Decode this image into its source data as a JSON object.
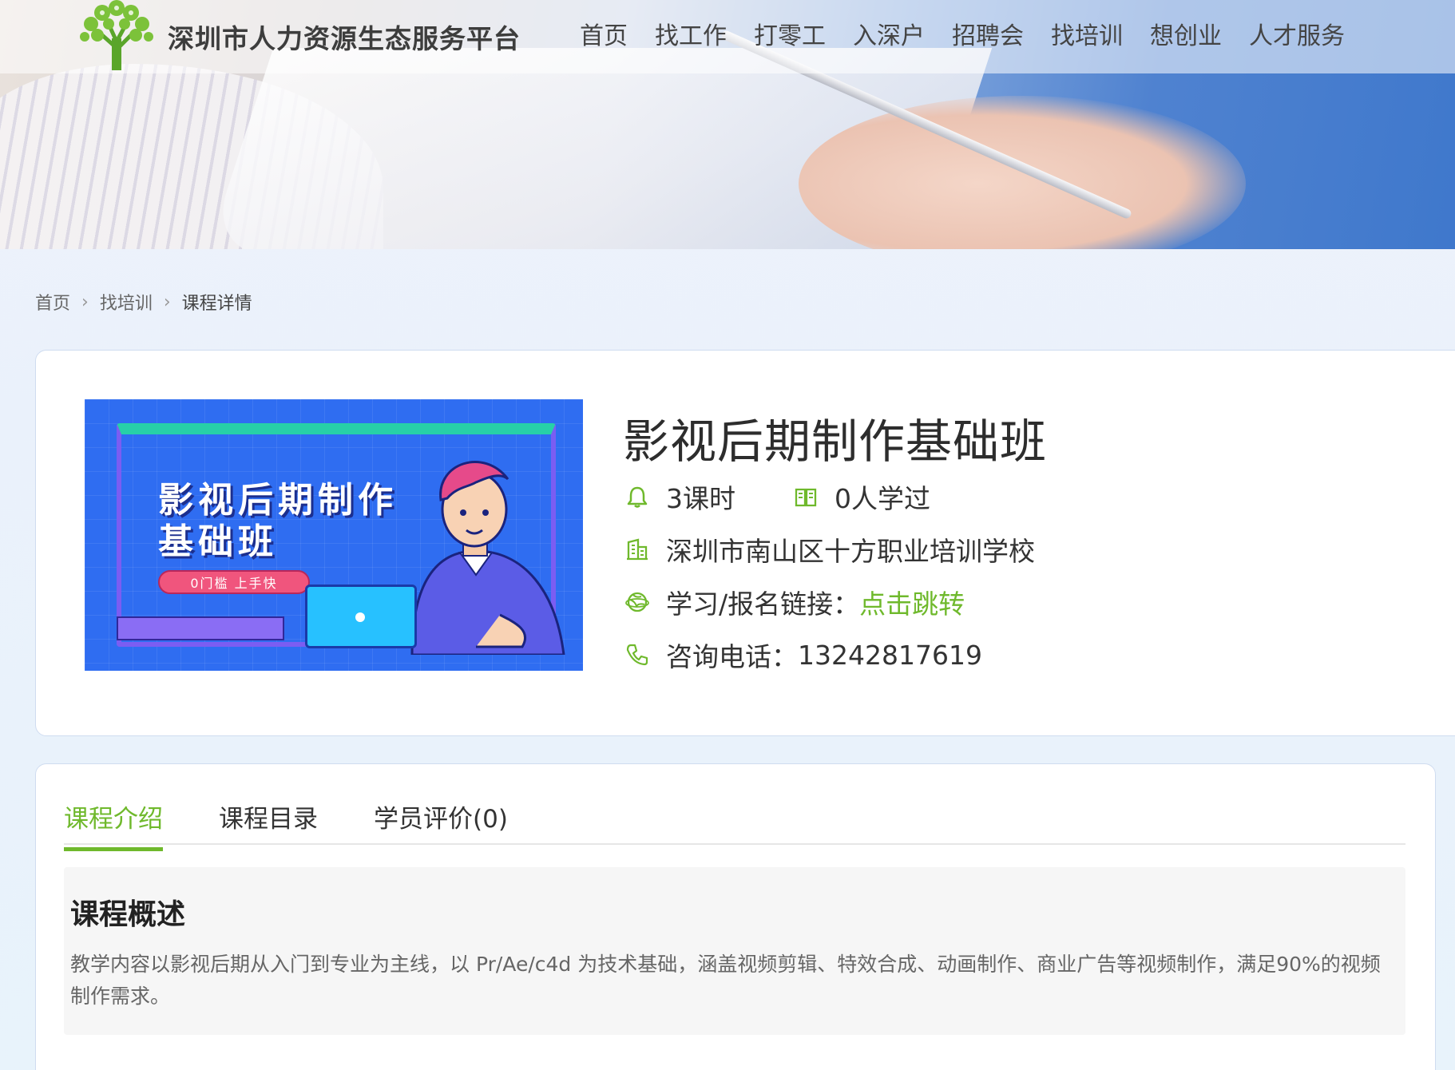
{
  "site": {
    "name": "深圳市人力资源生态服务平台"
  },
  "nav": {
    "items": [
      "首页",
      "找工作",
      "打零工",
      "入深户",
      "招聘会",
      "找培训",
      "想创业",
      "人才服务"
    ]
  },
  "breadcrumb": {
    "items": [
      "首页",
      "找培训",
      "课程详情"
    ]
  },
  "course": {
    "cover": {
      "title_line1": "影视后期制作",
      "title_line2": "基础班",
      "tagline": "0门槛 上手快"
    },
    "title": "影视后期制作基础班",
    "hours": "3课时",
    "learners": "0人学过",
    "school": "深圳市南山区十方职业培训学校",
    "link_label": "学习/报名链接：",
    "link_text": "点击跳转",
    "phone_label": "咨询电话：",
    "phone": "13242817619"
  },
  "tabs": {
    "items": [
      "课程介绍",
      "课程目录",
      "学员评价(0)"
    ],
    "active_index": 0
  },
  "overview": {
    "heading": "课程概述",
    "text": "教学内容以影视后期从入门到专业为主线，以 Pr/Ae/c4d 为技术基础，涵盖视频剪辑、特效合成、动画制作、商业广告等视频制作，满足90%的视频制作需求。"
  },
  "colors": {
    "accent": "#6fb92c",
    "card_border": "#cfdcf0",
    "cover_bg": "#2f6df1"
  },
  "icons": [
    "logo-tree-icon",
    "chevron-right-icon",
    "bell-icon",
    "book-icon",
    "building-icon",
    "globe-icon",
    "phone-icon"
  ]
}
